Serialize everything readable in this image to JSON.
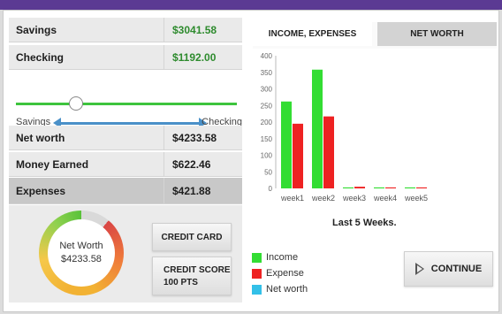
{
  "balances": {
    "savings_label": "Savings",
    "savings_value": "$3041.58",
    "checking_label": "Checking",
    "checking_value": "$1192.00"
  },
  "transfer": {
    "left_label": "Savings",
    "right_label": "Checking",
    "slider_position": 0.27
  },
  "summary": {
    "net_worth_label": "Net worth",
    "net_worth_value": "$4233.58",
    "earned_label": "Money Earned",
    "earned_value": "$622.46",
    "expenses_label": "Expenses",
    "expenses_value": "$421.88"
  },
  "gauge": {
    "title": "Net Worth",
    "value": "$4233.58"
  },
  "buttons": {
    "credit_card": "CREDIT CARD",
    "credit_score_title": "CREDIT SCORE",
    "credit_score_value": "100 PTS",
    "continue": "CONTINUE"
  },
  "tabs": [
    {
      "label": "INCOME, EXPENSES",
      "active": true
    },
    {
      "label": "NET WORTH",
      "active": false
    }
  ],
  "chart_caption": "Last 5 Weeks.",
  "legend": [
    {
      "label": "Income",
      "color": "#33dd33"
    },
    {
      "label": "Expense",
      "color": "#ee2222"
    },
    {
      "label": "Net worth",
      "color": "#33c0e8"
    }
  ],
  "colors": {
    "brand_bar": "#5b3a93",
    "money_green": "#2e8b2e",
    "slider_green": "#3ec43e",
    "arrow_blue": "#4a90c8"
  },
  "chart_data": {
    "type": "bar",
    "categories": [
      "week1",
      "week2",
      "week3",
      "week4",
      "week5"
    ],
    "series": [
      {
        "name": "Income",
        "values": [
          262,
          358,
          3,
          3,
          3
        ]
      },
      {
        "name": "Expense",
        "values": [
          195,
          217,
          5,
          3,
          3
        ]
      }
    ],
    "ylim": [
      0,
      400
    ],
    "yticks": [
      0,
      50,
      100,
      150,
      200,
      250,
      300,
      350,
      400
    ],
    "grid": false
  }
}
